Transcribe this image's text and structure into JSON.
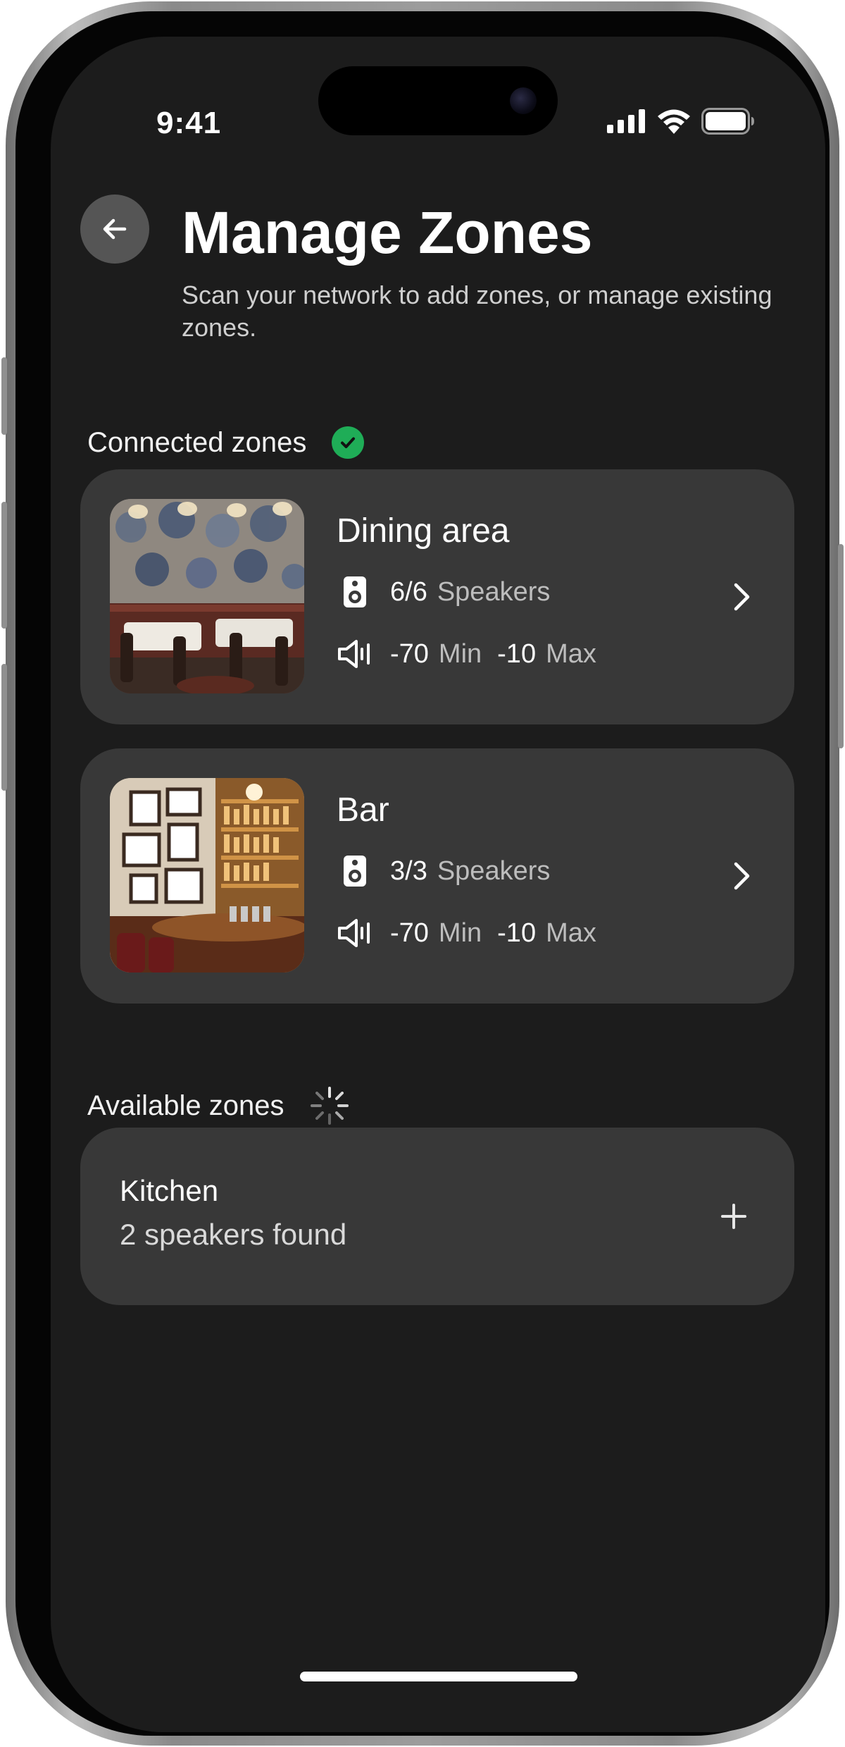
{
  "status_bar": {
    "time": "9:41"
  },
  "header": {
    "title": "Manage Zones",
    "subtitle": "Scan your network to add zones, or manage existing zones."
  },
  "connected": {
    "label": "Connected zones",
    "status_color": "#1fad57",
    "zones": [
      {
        "name": "Dining area",
        "speakers_count": "6/6",
        "speakers_label": "Speakers",
        "min_value": "-70",
        "min_label": "Min",
        "max_value": "-10",
        "max_label": "Max"
      },
      {
        "name": "Bar",
        "speakers_count": "3/3",
        "speakers_label": "Speakers",
        "min_value": "-70",
        "min_label": "Min",
        "max_value": "-10",
        "max_label": "Max"
      }
    ]
  },
  "available": {
    "label": "Available zones",
    "zones": [
      {
        "name": "Kitchen",
        "subtitle": "2 speakers found"
      }
    ]
  },
  "colors": {
    "screen_bg": "#1c1c1c",
    "card_bg": "#383838",
    "back_button_bg": "#555555"
  },
  "icons": {
    "back": "arrow-left-icon",
    "speaker": "speaker-icon",
    "volume": "volume-icon",
    "chevron": "chevron-right-icon",
    "add": "plus-icon",
    "scanning": "spinner-icon",
    "connected": "check-circle-icon"
  }
}
